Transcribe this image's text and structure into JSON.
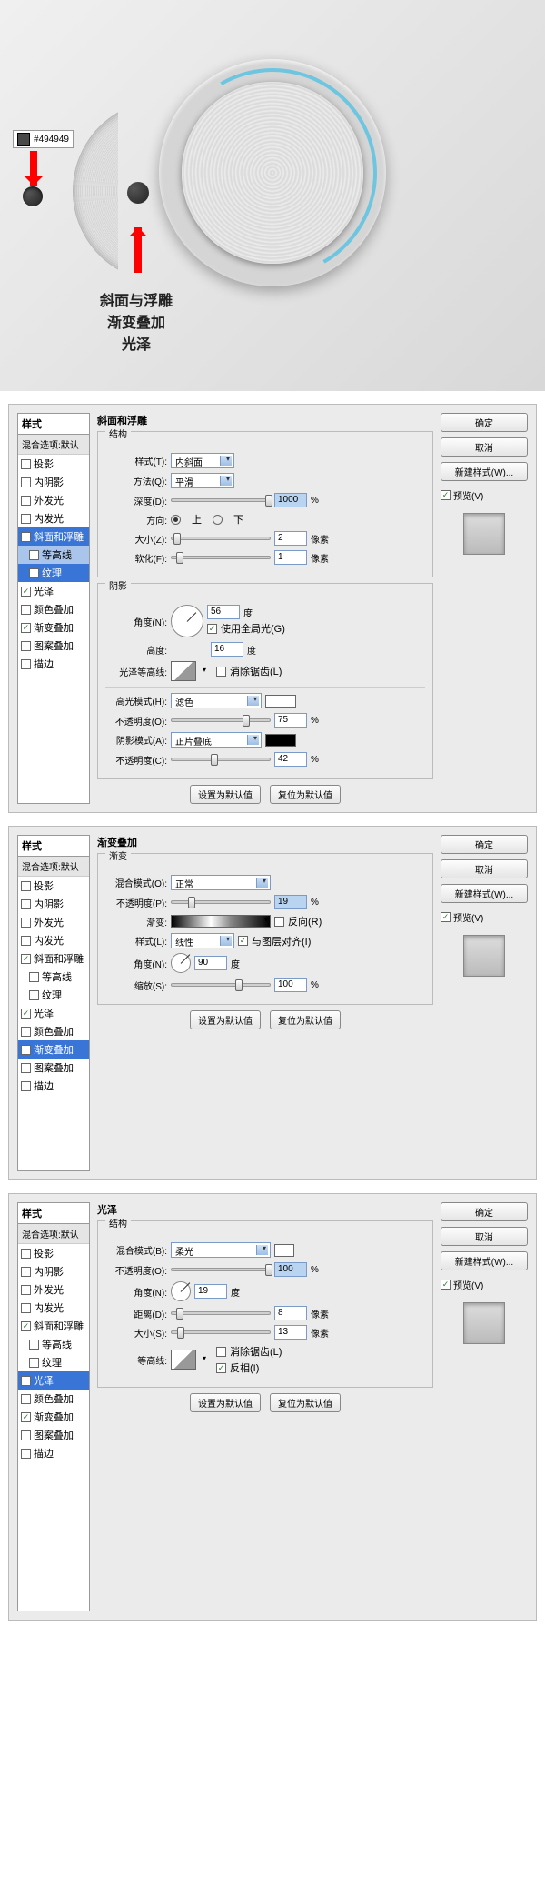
{
  "illustration": {
    "color_hex": "494949",
    "label1": "斜面与浮雕",
    "label2": "渐变叠加",
    "label3": "光泽"
  },
  "common": {
    "styles_header": "样式",
    "blend_defaults": "混合选项:默认",
    "ok": "确定",
    "cancel": "取消",
    "new_style": "新建样式(W)...",
    "preview": "预览(V)",
    "set_default": "设置为默认值",
    "reset_default": "复位为默认值"
  },
  "style_items": {
    "drop_shadow": "投影",
    "inner_shadow": "内阴影",
    "outer_glow": "外发光",
    "inner_glow": "内发光",
    "bevel": "斜面和浮雕",
    "contour": "等高线",
    "texture": "纹理",
    "satin": "光泽",
    "color_overlay": "颜色叠加",
    "gradient_overlay": "渐变叠加",
    "pattern_overlay": "图案叠加",
    "stroke": "描边"
  },
  "panel1": {
    "title": "斜面和浮雕",
    "structure": "结构",
    "style_lbl": "样式(T):",
    "style_val": "内斜面",
    "method_lbl": "方法(Q):",
    "method_val": "平滑",
    "depth_lbl": "深度(D):",
    "depth_val": "1000",
    "direction_lbl": "方向:",
    "dir_up": "上",
    "dir_down": "下",
    "size_lbl": "大小(Z):",
    "size_val": "2",
    "soften_lbl": "软化(F):",
    "soften_val": "1",
    "px": "像素",
    "pct": "%",
    "shading": "阴影",
    "angle_lbl": "角度(N):",
    "angle_val": "56",
    "deg": "度",
    "global_light": "使用全局光(G)",
    "altitude_lbl": "高度:",
    "altitude_val": "16",
    "gloss_contour": "光泽等高线:",
    "anti_alias": "消除锯齿(L)",
    "highlight_mode": "高光模式(H):",
    "highlight_val": "滤色",
    "opacity_lbl": "不透明度(O):",
    "hi_opacity": "75",
    "shadow_mode": "阴影模式(A):",
    "shadow_val": "正片叠底",
    "sh_opacity_lbl": "不透明度(C):",
    "sh_opacity": "42"
  },
  "panel2": {
    "title": "渐变叠加",
    "gradient": "渐变",
    "blend_lbl": "混合模式(O):",
    "blend_val": "正常",
    "opacity_lbl": "不透明度(P):",
    "opacity_val": "19",
    "gradient_lbl": "渐变:",
    "reverse": "反向(R)",
    "style_lbl": "样式(L):",
    "style_val": "线性",
    "align_layer": "与图层对齐(I)",
    "angle_lbl": "角度(N):",
    "angle_val": "90",
    "deg": "度",
    "scale_lbl": "缩放(S):",
    "scale_val": "100",
    "pct": "%"
  },
  "panel3": {
    "title": "光泽",
    "structure": "结构",
    "blend_lbl": "混合模式(B):",
    "blend_val": "柔光",
    "opacity_lbl": "不透明度(O):",
    "opacity_val": "100",
    "angle_lbl": "角度(N):",
    "angle_val": "19",
    "deg": "度",
    "distance_lbl": "距离(D):",
    "distance_val": "8",
    "size_lbl": "大小(S):",
    "size_val": "13",
    "px": "像素",
    "contour_lbl": "等高线:",
    "anti_alias": "消除锯齿(L)",
    "invert": "反相(I)",
    "pct": "%"
  }
}
